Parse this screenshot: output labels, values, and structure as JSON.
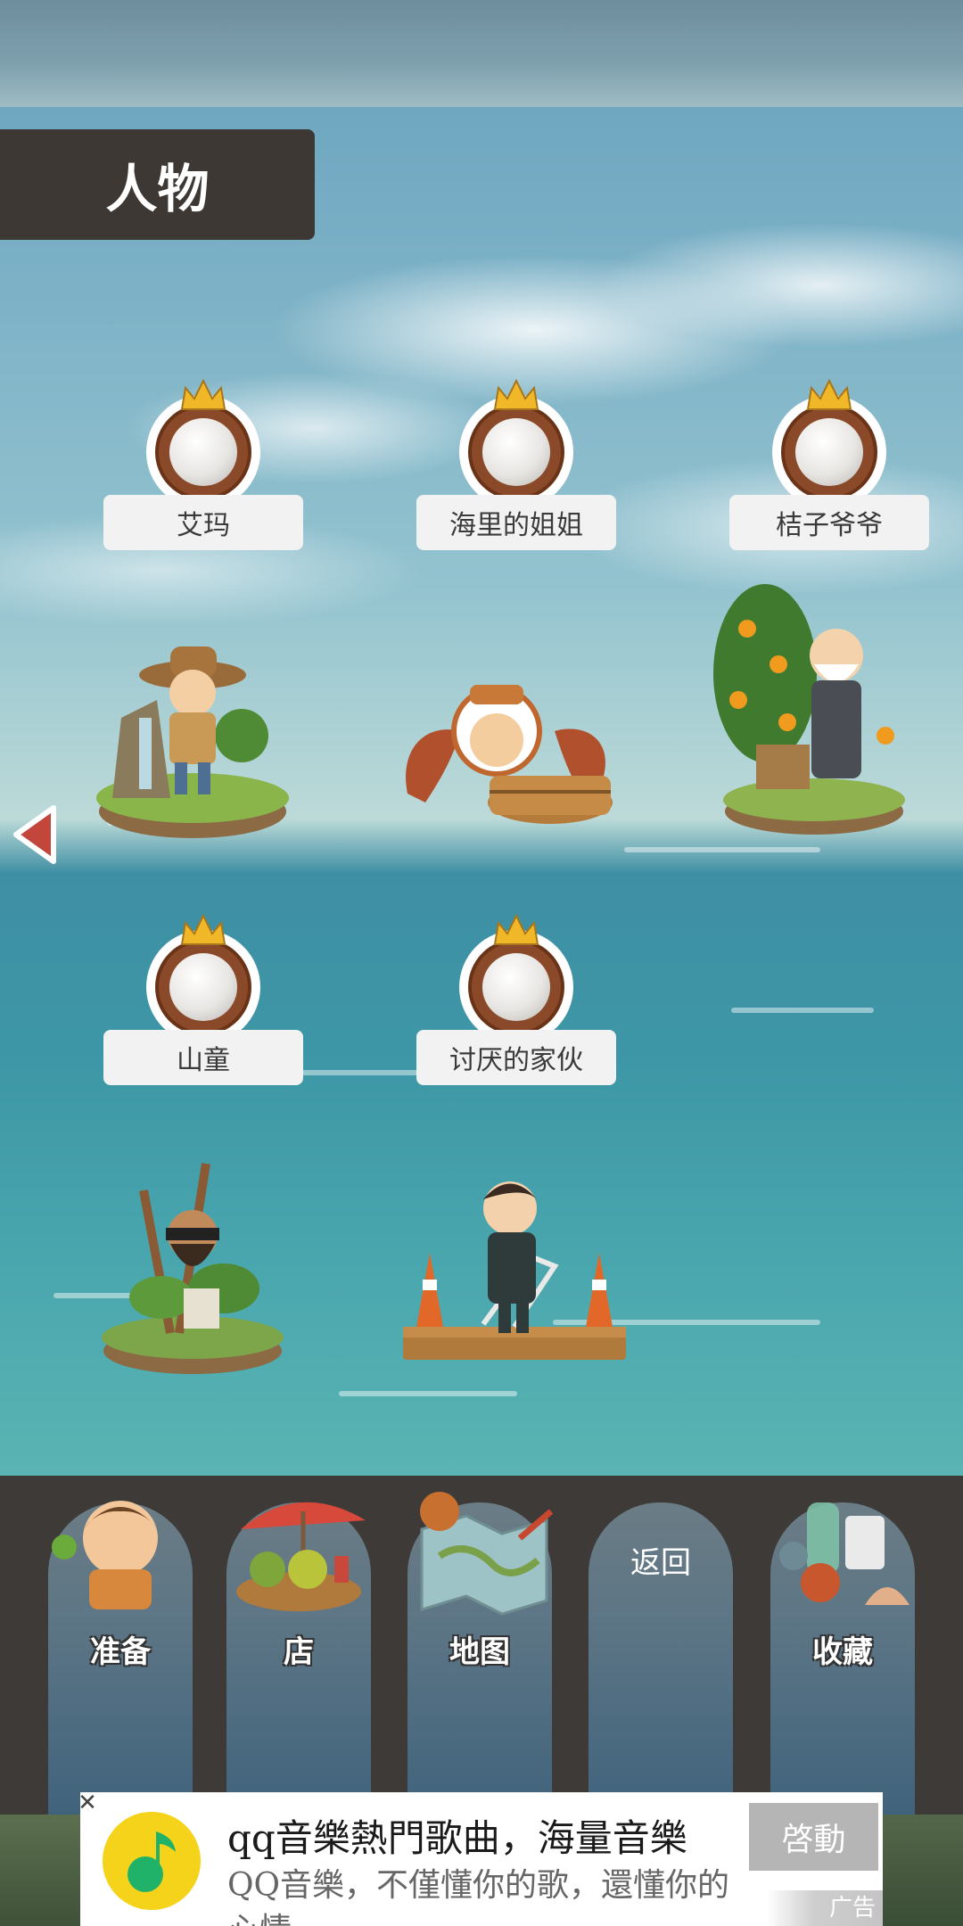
{
  "screen_title": "人物",
  "characters": [
    {
      "name": "艾玛",
      "figure": "explorer-on-rock-island"
    },
    {
      "name": "海里的姐姐",
      "figure": "octopus-diver-with-tub"
    },
    {
      "name": "桔子爷爷",
      "figure": "old-man-on-orange-tree-island"
    },
    {
      "name": "山童",
      "figure": "bearded-man-on-grass-island"
    },
    {
      "name": "讨厌的家伙",
      "figure": "suited-man-on-raft"
    }
  ],
  "nav": {
    "prepare": "准备",
    "shop": "店",
    "map": "地图",
    "back": "返回",
    "collection": "收藏"
  },
  "ad": {
    "close": "✕",
    "title": "qq音樂熱門歌曲，海量音樂",
    "description": "QQ音樂，不僅懂你的歌，還懂你的心情",
    "cta": "啓動",
    "tag": "广告"
  },
  "colors": {
    "title_bg": "#3e3835",
    "label_bg": "#f2f2f2",
    "nav_bg": "#3e3a38",
    "accent_red": "#c2463c",
    "medal_brown": "#8a4a2a",
    "crown_gold": "#f0b829"
  }
}
